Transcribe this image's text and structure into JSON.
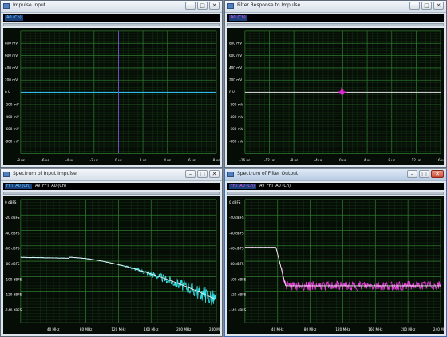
{
  "windows": [
    {
      "key": "impulse_input",
      "title": "Impulse Input",
      "legend": [
        {
          "label": "A0 (Ch)",
          "color": "#6fd3ff",
          "selected": true
        }
      ],
      "x_ticks": [
        "-8 us",
        "-6 us",
        "-4 us",
        "-2 us",
        "0 us",
        "2 us",
        "4 us",
        "6 us",
        "8 us"
      ],
      "y_ticks": [
        "800 mV",
        "600 mV",
        "400 mV",
        "200 mV",
        "0 V",
        "-200 mV",
        "-400 mV",
        "-600 mV",
        "-800 mV"
      ],
      "trace_color": "#2fb9e6",
      "spike_color": "#7a4fd0"
    },
    {
      "key": "filter_response",
      "title": "Filter Response to Impulse",
      "legend": [
        {
          "label": "A0 (Ch)",
          "color": "#ff4fe0",
          "selected": true
        }
      ],
      "x_ticks": [
        "-16 us",
        "-12 us",
        "-8 us",
        "-4 us",
        "0 us",
        "4 us",
        "8 us",
        "12 us",
        "16 us"
      ],
      "y_ticks": [
        "800 mV",
        "600 mV",
        "400 mV",
        "200 mV",
        "0 V",
        "-200 mV",
        "-400 mV",
        "-600 mV",
        "-800 mV"
      ],
      "trace_color": "#c8c8c8",
      "spike_color": "#e02ad0"
    },
    {
      "key": "input_spectrum",
      "title": "Spectrum of Input Impulse",
      "legend": [
        {
          "label": "FFT_A0 (Ch)",
          "color": "#6fd3ff",
          "selected": true
        },
        {
          "label": "AV_FFT_A0 (Ch)",
          "color": "#ffffff",
          "selected": false
        }
      ],
      "x_ticks": [
        "40 MHz",
        "80 MHz",
        "120 MHz",
        "160 MHz",
        "200 MHz",
        "240 MHz"
      ],
      "y_ticks": [
        "0 dBFS",
        "-20 dBFS",
        "-40 dBFS",
        "-60 dBFS",
        "-80 dBFS",
        "-100 dBFS",
        "-120 dBFS",
        "-140 dBFS"
      ],
      "trace_color": "#35e0e6",
      "avg_color": "#f2f2f2"
    },
    {
      "key": "output_spectrum",
      "title": "Spectrum of Filter Output",
      "legend": [
        {
          "label": "FFT_A0 (Ch)",
          "color": "#ff4fe0",
          "selected": true
        },
        {
          "label": "AV_FFT_A0 (Ch)",
          "color": "#ffffff",
          "selected": false
        }
      ],
      "x_ticks": [
        "40 MHz",
        "80 MHz",
        "120 MHz",
        "160 MHz",
        "200 MHz",
        "240 MHz"
      ],
      "y_ticks": [
        "0 dBFS",
        "-20 dBFS",
        "-40 dBFS",
        "-60 dBFS",
        "-80 dBFS",
        "-100 dBFS",
        "-120 dBFS",
        "-140 dBFS"
      ],
      "trace_color": "#ee3fe0",
      "avg_color": "#f2f2f2"
    }
  ],
  "buttons": {
    "minimize": "–",
    "maximize": "□",
    "close": "✕"
  }
}
